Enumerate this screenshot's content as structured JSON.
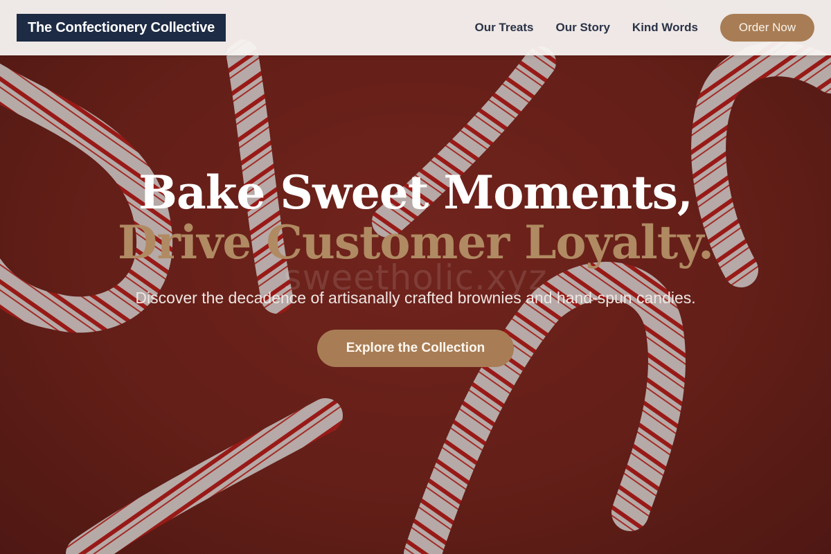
{
  "header": {
    "logo_text": "The Confectionery Collective",
    "nav": [
      {
        "label": "Our Treats"
      },
      {
        "label": "Our Story"
      },
      {
        "label": "Kind Words"
      }
    ],
    "order_button": "Order Now"
  },
  "hero": {
    "headline_line1": "Bake Sweet Moments,",
    "headline_line2": "Drive Customer Loyalty.",
    "watermark": "sweetholic.xyz",
    "subtitle": "Discover the decadence of artisanally crafted brownies and hand-spun candies.",
    "cta_button": "Explore the Collection",
    "background_image": "candy-canes-on-red-background"
  },
  "colors": {
    "logo_background": "#1d2b44",
    "accent": "#a87d55",
    "headline_accent": "#b08a62",
    "hero_background": "#7b271f"
  }
}
